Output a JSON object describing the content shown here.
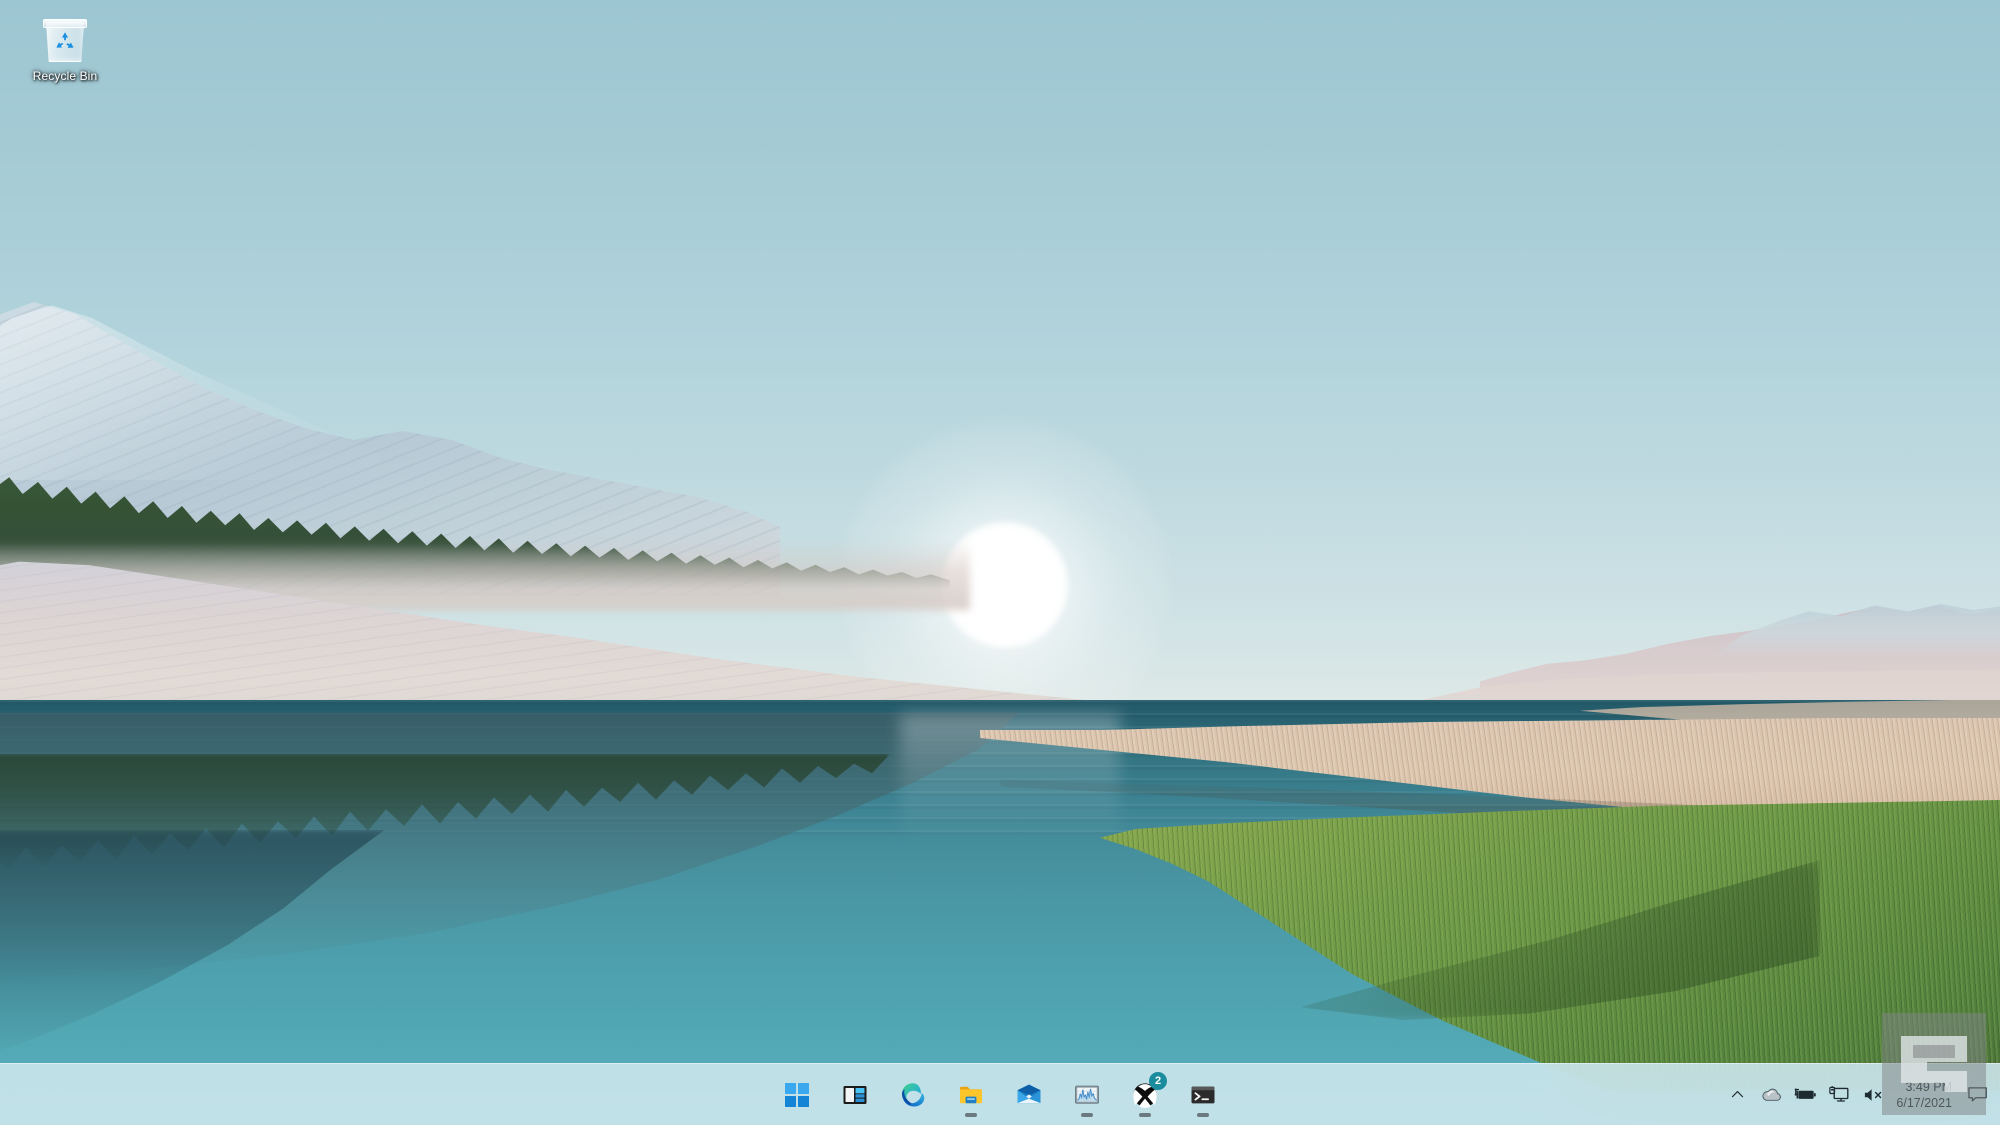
{
  "desktop": {
    "icons": [
      {
        "name": "recycle-bin",
        "label": "Recycle Bin"
      }
    ]
  },
  "wallpaper": {
    "name": "windows-11-bloom-lake-sunrise",
    "description": "Snowy mountains with conifer trees, a bright sun over a calm teal lake, tan reeds and green grass on the right shore",
    "sky_color_top": "#9cc6d2",
    "sky_color_horizon": "#dfe9e7",
    "water_color_far": "#2d6a79",
    "water_color_near": "#5db3bf",
    "grass_color": "#6b9745",
    "reeds_color": "#d9c3ae",
    "snow_color": "#cfdde5"
  },
  "taskbar": {
    "background_color": "#cfe7ee",
    "accent_color": "#1a8c9e",
    "apps": [
      {
        "name": "start",
        "label": "Start",
        "icon": "windows-logo-icon",
        "running": false,
        "badge": null
      },
      {
        "name": "widgets",
        "label": "Widgets",
        "icon": "widgets-icon",
        "running": false,
        "badge": null
      },
      {
        "name": "edge",
        "label": "Microsoft Edge",
        "icon": "edge-icon",
        "running": true,
        "badge": null
      },
      {
        "name": "file-explorer",
        "label": "File Explorer",
        "icon": "folder-icon",
        "running": true,
        "badge": null
      },
      {
        "name": "mail",
        "label": "Mail",
        "icon": "mail-icon",
        "running": false,
        "badge": null
      },
      {
        "name": "task-manager",
        "label": "Task Manager",
        "icon": "performance-chart-icon",
        "running": true,
        "badge": null
      },
      {
        "name": "xbox",
        "label": "Xbox",
        "icon": "xbox-icon",
        "running": true,
        "badge": "2"
      },
      {
        "name": "terminal",
        "label": "Windows Terminal",
        "icon": "terminal-icon",
        "running": true,
        "badge": null
      }
    ],
    "tray": {
      "items": [
        {
          "name": "show-hidden-icons",
          "label": "Show hidden icons",
          "icon": "chevron-up-icon"
        },
        {
          "name": "onedrive",
          "label": "OneDrive",
          "icon": "cloud-icon"
        },
        {
          "name": "battery",
          "label": "Battery charging",
          "icon": "battery-charging-icon"
        },
        {
          "name": "network",
          "label": "Network",
          "icon": "monitor-network-icon"
        },
        {
          "name": "volume",
          "label": "Volume muted",
          "icon": "speaker-muted-icon"
        }
      ],
      "clock": {
        "time": "3:49 PM",
        "date": "6/17/2021"
      },
      "notifications": {
        "name": "notification-center",
        "label": "Notifications",
        "icon": "chat-bubble-icon"
      }
    }
  },
  "watermark": {
    "label": "Engadget",
    "icon": "engadget-e-logo"
  }
}
